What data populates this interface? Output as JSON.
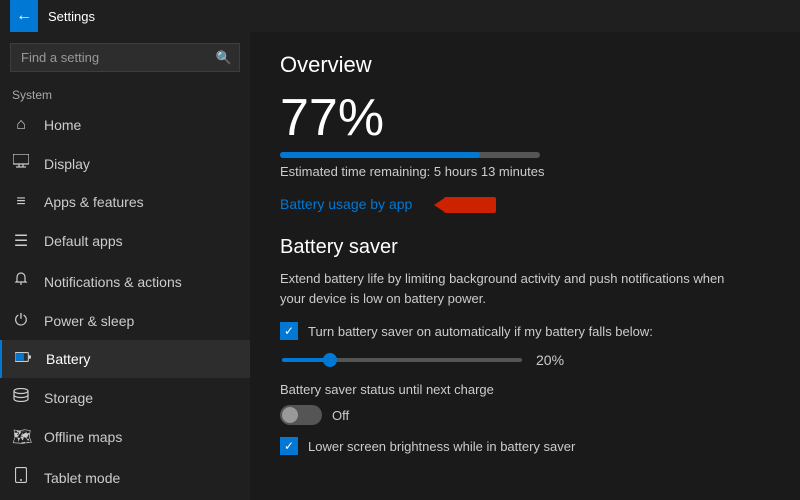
{
  "titlebar": {
    "back_icon": "←",
    "title": "Settings"
  },
  "sidebar": {
    "search_placeholder": "Find a setting",
    "search_icon": "🔍",
    "section_label": "System",
    "items": [
      {
        "id": "home",
        "label": "Home",
        "icon": "⌂"
      },
      {
        "id": "display",
        "label": "Display",
        "icon": "🖥"
      },
      {
        "id": "apps-features",
        "label": "Apps & features",
        "icon": "≡"
      },
      {
        "id": "default-apps",
        "label": "Default apps",
        "icon": "☰"
      },
      {
        "id": "notifications",
        "label": "Notifications & actions",
        "icon": "🔔"
      },
      {
        "id": "power-sleep",
        "label": "Power & sleep",
        "icon": "⏻"
      },
      {
        "id": "battery",
        "label": "Battery",
        "icon": "□",
        "active": true
      },
      {
        "id": "storage",
        "label": "Storage",
        "icon": "💾"
      },
      {
        "id": "offline-maps",
        "label": "Offline maps",
        "icon": "🗺"
      },
      {
        "id": "tablet-mode",
        "label": "Tablet mode",
        "icon": "📱"
      }
    ]
  },
  "content": {
    "overview_title": "Overview",
    "battery_percent": "77%",
    "estimated_time": "Estimated time remaining: 5 hours 13 minutes",
    "battery_usage_link": "Battery usage by app",
    "battery_saver_title": "Battery saver",
    "battery_saver_description": "Extend battery life by limiting background activity and push notifications when your device is low on battery power.",
    "auto_saver_label": "Turn battery saver on automatically if my battery falls below:",
    "slider_value": "20%",
    "status_label": "Battery saver status until next charge",
    "toggle_label": "Off",
    "lower_brightness_label": "Lower screen brightness while in battery saver"
  }
}
